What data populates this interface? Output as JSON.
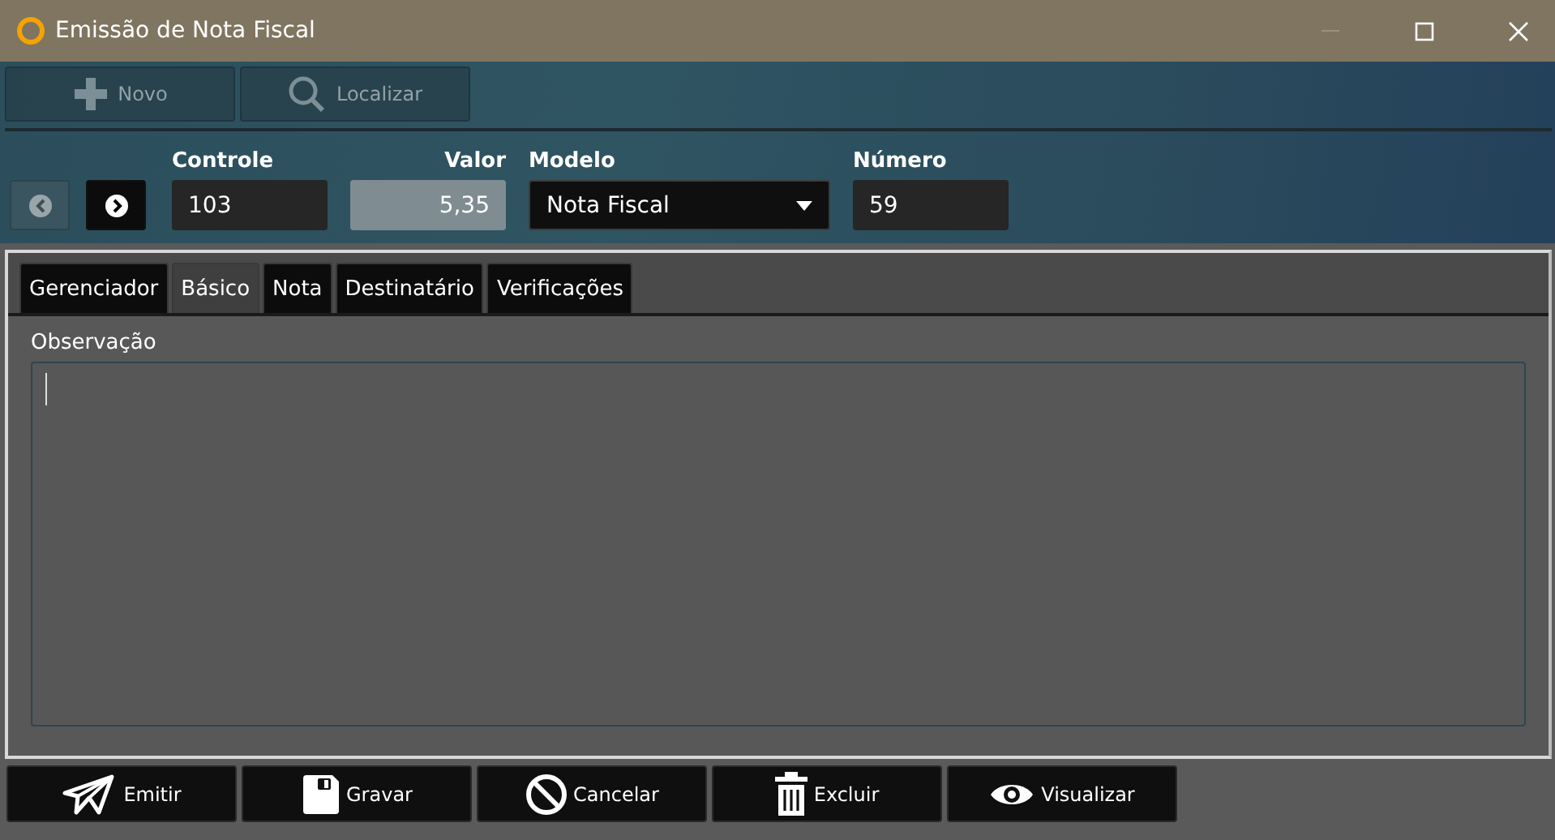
{
  "window": {
    "title": "Emissão de Nota Fiscal",
    "controls": [
      {
        "kind": "minimize",
        "disabled": true
      },
      {
        "kind": "maximize",
        "disabled": false
      },
      {
        "kind": "close",
        "disabled": false
      }
    ]
  },
  "toolbar": [
    {
      "kind": "new",
      "label": "Novo",
      "disabled": true
    },
    {
      "kind": "search",
      "label": "Localizar",
      "disabled": true
    }
  ],
  "nav": [
    {
      "kind": "prev",
      "disabled": true
    },
    {
      "kind": "next",
      "disabled": false
    }
  ],
  "fields": [
    {
      "kind": "text",
      "label": "Controle",
      "value": "103",
      "disabled": false
    },
    {
      "kind": "number",
      "label": "Valor",
      "value": "5,35",
      "disabled": true
    },
    {
      "kind": "select",
      "label": "Modelo",
      "value": "Nota Fiscal",
      "disabled": false
    },
    {
      "kind": "text",
      "label": "Número",
      "value": "59",
      "disabled": false
    }
  ],
  "tabs": [
    {
      "label": "Gerenciador",
      "selected": false
    },
    {
      "label": "Básico",
      "selected": true
    },
    {
      "label": "Nota",
      "selected": false
    },
    {
      "label": "Destinatário",
      "selected": false
    },
    {
      "label": "Verificações",
      "selected": false
    }
  ],
  "observation": {
    "label": "Observação"
  },
  "actions": [
    {
      "kind": "send",
      "label": "Emitir"
    },
    {
      "kind": "save",
      "label": "Gravar"
    },
    {
      "kind": "cancel",
      "label": "Cancelar"
    },
    {
      "kind": "delete",
      "label": "Excluir"
    },
    {
      "kind": "view",
      "label": "Visualizar"
    }
  ]
}
